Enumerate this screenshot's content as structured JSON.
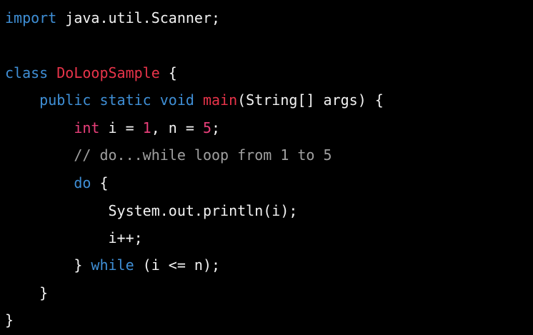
{
  "colors": {
    "background": "#000000",
    "text": "#f2f2f2",
    "keyword": "#3f8fd6",
    "class_name": "#e8344a",
    "type_and_number": "#e93f7a",
    "comment": "#a0a0a0"
  },
  "code": {
    "line1": {
      "kw": "import",
      "rest": " java.util.Scanner;"
    },
    "line3": {
      "kw": "class",
      "name": "DoLoopSample",
      "rest": " {"
    },
    "line4": {
      "kw": "public static void",
      "method": "main",
      "rest": "(String[] args) {"
    },
    "line5": {
      "type": "int",
      "var": " i = ",
      "one": "1",
      "mid": ", n = ",
      "five": "5",
      "end": ";"
    },
    "line6": {
      "comment": "// do...while loop from 1 to 5"
    },
    "line7": {
      "kw": "do",
      "rest": " {"
    },
    "line8": {
      "text": "System.out.println(i);"
    },
    "line9": {
      "text": "i++;"
    },
    "line10": {
      "pre": "} ",
      "kw": "while",
      "rest": " (i <= n);"
    },
    "line11": {
      "text": "}"
    },
    "line12": {
      "text": "}"
    }
  }
}
